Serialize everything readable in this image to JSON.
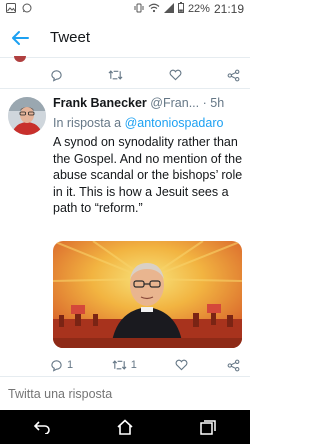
{
  "status_bar": {
    "battery_percent": "22%",
    "time": "21:19",
    "icons": [
      "image-icon",
      "whatsapp-icon",
      "vibrate-icon",
      "wifi-icon",
      "signal-icon",
      "battery-icon"
    ]
  },
  "header": {
    "title": "Tweet",
    "back_icon": "arrow-left-icon"
  },
  "tweet": {
    "author_name": "Frank Banecker",
    "author_handle": "@Fran...",
    "age_separator": "·",
    "age": "5h",
    "reply_prefix": "In risposta a",
    "reply_to": "@antoniospadaro",
    "text": "A synod on synodality rather than the Gospel. And no mention of the abuse scandal or the bishops’ role in it. This is how a Jesuit sees a path to “reform.”",
    "replies": "1",
    "retweets": "1",
    "likes": "",
    "media_description_icon": "illustrated-priest-image"
  },
  "reply_input": {
    "placeholder": "Twitta una risposta"
  },
  "colors": {
    "accent": "#1da1f2",
    "secondary_text": "#657786",
    "divider": "#e6ecf0"
  }
}
